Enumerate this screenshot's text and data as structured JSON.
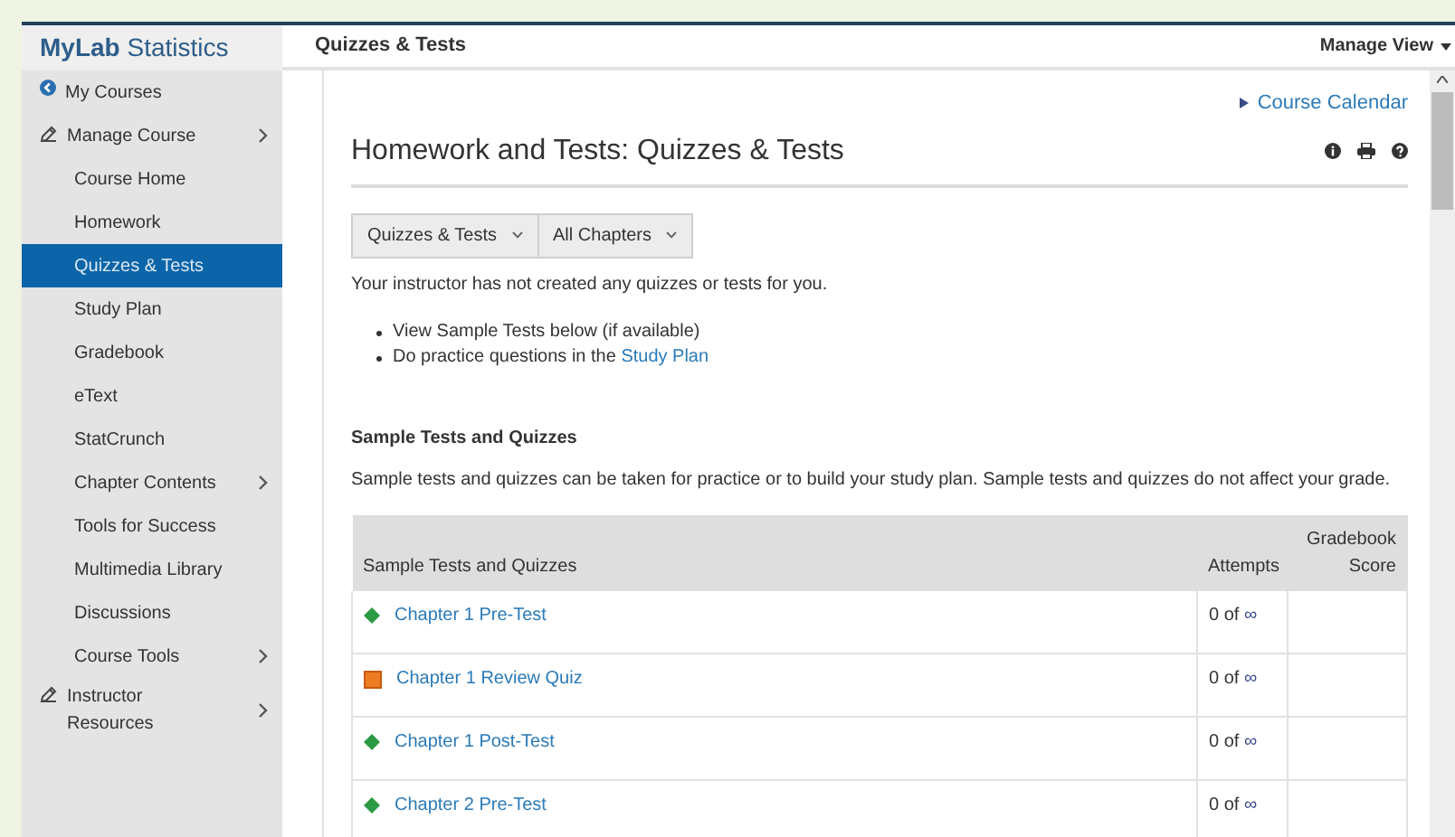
{
  "sidebar": {
    "brand": {
      "bold": "MyLab",
      "rest": "Statistics"
    },
    "items": [
      {
        "label": "My Courses",
        "kind": "back",
        "expandable": false,
        "selected": false
      },
      {
        "label": "Manage Course",
        "kind": "tool",
        "expandable": true,
        "selected": false
      },
      {
        "label": "Course Home",
        "kind": "sub",
        "expandable": false,
        "selected": false
      },
      {
        "label": "Homework",
        "kind": "sub",
        "expandable": false,
        "selected": false
      },
      {
        "label": "Quizzes & Tests",
        "kind": "sub",
        "expandable": false,
        "selected": true
      },
      {
        "label": "Study Plan",
        "kind": "sub",
        "expandable": false,
        "selected": false
      },
      {
        "label": "Gradebook",
        "kind": "sub",
        "expandable": false,
        "selected": false
      },
      {
        "label": "eText",
        "kind": "sub",
        "expandable": false,
        "selected": false
      },
      {
        "label": "StatCrunch",
        "kind": "sub",
        "expandable": false,
        "selected": false
      },
      {
        "label": "Chapter Contents",
        "kind": "sub",
        "expandable": true,
        "selected": false
      },
      {
        "label": "Tools for Success",
        "kind": "sub",
        "expandable": false,
        "selected": false
      },
      {
        "label": "Multimedia Library",
        "kind": "sub",
        "expandable": false,
        "selected": false
      },
      {
        "label": "Discussions",
        "kind": "sub",
        "expandable": false,
        "selected": false
      },
      {
        "label": "Course Tools",
        "kind": "sub",
        "expandable": true,
        "selected": false
      },
      {
        "label": "Instructor Resources",
        "kind": "tool",
        "expandable": true,
        "selected": false
      }
    ]
  },
  "header": {
    "title": "Quizzes & Tests",
    "manage_view": "Manage View"
  },
  "content": {
    "calendar_link": "Course Calendar",
    "heading": "Homework and Tests: Quizzes & Tests",
    "filters": [
      "Quizzes & Tests",
      "All Chapters"
    ],
    "notice": "Your instructor has not created any quizzes or tests for you.",
    "bullets": [
      {
        "text": "View Sample Tests below (if available)"
      },
      {
        "text": "Do practice questions in the",
        "link": "Study Plan"
      }
    ],
    "section_title": "Sample Tests and Quizzes",
    "section_text": "Sample tests and quizzes can be taken for practice or to build your study plan. Sample tests and quizzes do not affect your grade.",
    "table": {
      "columns": [
        "Sample Tests and Quizzes",
        "Attempts",
        "Gradebook Score"
      ],
      "rows": [
        {
          "name": "Chapter 1 Pre-Test",
          "kind": "test",
          "attempts": "0 of",
          "limit": "∞"
        },
        {
          "name": "Chapter 1 Review Quiz",
          "kind": "quiz",
          "attempts": "0 of",
          "limit": "∞"
        },
        {
          "name": "Chapter 1 Post-Test",
          "kind": "test",
          "attempts": "0 of",
          "limit": "∞"
        },
        {
          "name": "Chapter 2 Pre-Test",
          "kind": "test",
          "attempts": "0 of",
          "limit": "∞"
        }
      ]
    }
  }
}
